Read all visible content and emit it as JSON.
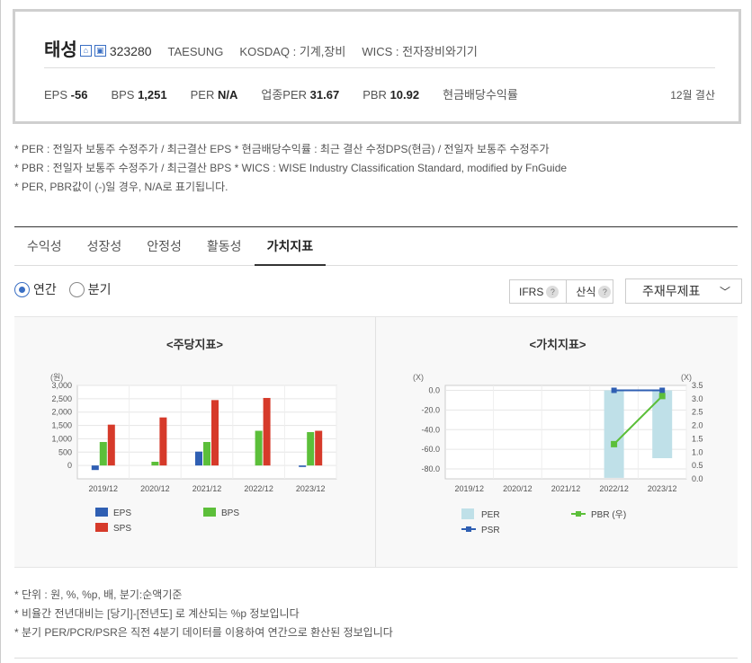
{
  "company": {
    "name": "태성",
    "code": "323280",
    "eng_name": "TAESUNG",
    "market": "KOSDAQ : 기계,장비",
    "wics": "WICS : 전자장비와기기",
    "icons": [
      "home-icon",
      "building-icon"
    ]
  },
  "metrics": [
    {
      "label": "EPS",
      "value": "-56"
    },
    {
      "label": "BPS",
      "value": "1,251"
    },
    {
      "label": "PER",
      "value": "N/A"
    },
    {
      "label": "업종PER",
      "value": "31.67"
    },
    {
      "label": "PBR",
      "value": "10.92"
    },
    {
      "label": "현금배당수익률",
      "value": ""
    }
  ],
  "settlement": "12월 결산",
  "notes": [
    "* PER : 전일자 보통주 수정주가 / 최근결산 EPS * 현금배당수익률 : 최근 결산 수정DPS(현금) / 전일자 보통주 수정주가",
    "* PBR : 전일자 보통주 수정주가 / 최근결산 BPS * WICS : WISE Industry Classification Standard, modified by FnGuide",
    "* PER, PBR값이 (-)일 경우, N/A로 표기됩니다."
  ],
  "tabs": [
    {
      "label": "수익성",
      "active": false
    },
    {
      "label": "성장성",
      "active": false
    },
    {
      "label": "안정성",
      "active": false
    },
    {
      "label": "활동성",
      "active": false
    },
    {
      "label": "가치지표",
      "active": true
    }
  ],
  "period_options": [
    {
      "label": "연간",
      "selected": true
    },
    {
      "label": "분기",
      "selected": false
    }
  ],
  "ifrs_label": "IFRS",
  "calc_label": "산식",
  "help_glyph": "?",
  "statement_select": "주재무제표",
  "chart_data": [
    {
      "type": "bar",
      "title": "<주당지표>",
      "unit_label": "(원)",
      "categories": [
        "2019/12",
        "2020/12",
        "2021/12",
        "2022/12",
        "2023/12"
      ],
      "ylim": [
        -500,
        3000
      ],
      "yticks": [
        0,
        500,
        1000,
        1500,
        2000,
        2500,
        3000
      ],
      "ytick_labels": [
        "0",
        "500",
        "1,000",
        "1,500",
        "2,000",
        "2,500",
        "3,000"
      ],
      "series": [
        {
          "name": "EPS",
          "color": "#2f5fb3",
          "values": [
            -170,
            0,
            520,
            0,
            -56
          ]
        },
        {
          "name": "BPS",
          "color": "#5cbf3a",
          "values": [
            880,
            140,
            880,
            1300,
            1251
          ]
        },
        {
          "name": "SPS",
          "color": "#d63a2a",
          "values": [
            1530,
            1800,
            2450,
            2530,
            1300
          ]
        }
      ],
      "grid": true,
      "legend": "bottom"
    },
    {
      "type": "bar",
      "title": "<가치지표>",
      "left_unit": "(X)",
      "right_unit": "(X)",
      "categories": [
        "2019/12",
        "2020/12",
        "2021/12",
        "2022/12",
        "2023/12"
      ],
      "ylim_left": [
        -90,
        5
      ],
      "yticks_left": [
        "0.0",
        "-20.0",
        "-40.0",
        "-60.0",
        "-80.0"
      ],
      "ylim_right": [
        0,
        3.5
      ],
      "yticks_right": [
        "3.5",
        "3.0",
        "2.5",
        "2.0",
        "1.5",
        "1.0",
        "0.5",
        "0.0"
      ],
      "series": [
        {
          "name": "PER",
          "kind": "bar",
          "axis": "left",
          "color": "#bfe0e8",
          "values": [
            null,
            null,
            null,
            -89,
            -69
          ]
        },
        {
          "name": "PSR",
          "kind": "line",
          "axis": "left",
          "color": "#2f5fb3",
          "values": [
            null,
            null,
            null,
            0,
            0
          ]
        },
        {
          "name": "PBR (우)",
          "kind": "line",
          "axis": "right",
          "color": "#5cbf3a",
          "values": [
            null,
            null,
            null,
            1.3,
            3.1
          ]
        }
      ],
      "grid": true,
      "legend": "bottom"
    }
  ],
  "footnotes": [
    "* 단위 : 원, %, %p, 배, 분기:순액기준",
    "* 비율간 전년대비는 [당기]-[전년도] 로 계산되는 %p 정보입니다",
    "* 분기 PER/PCR/PSR은 직전 4분기 데이터를 이용하여 연간으로 환산된 정보입니다"
  ]
}
